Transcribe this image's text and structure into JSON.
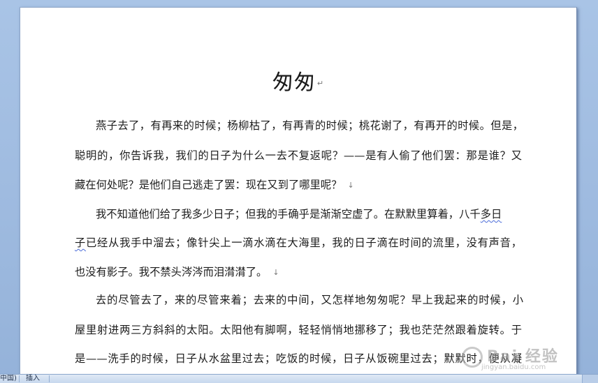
{
  "document": {
    "title": "匆匆",
    "paragraph_mark": "↵",
    "line_break_mark": "↓",
    "lines": [
      "燕子去了，有再来的时候；杨柳枯了，有再青的时候；桃花谢了，有再开的时候。但是，",
      "聪明的，你告诉我，我们的日子为什么一去不复返呢？——是有人偷了他们罢：那是谁？又",
      "藏在何处呢？是他们自己逃走了罢：现在又到了哪里呢？",
      "我不知道他们给了我多少日子；但我的手确乎是渐渐空虚了。在默默里算着，八千",
      "多日",
      "子",
      "已经从我手中溜去；像针尖上一滴水滴在大海里，我的日子滴在时间的流里，没有声音，",
      "也没有影子。我不禁头涔涔而泪潸潸了。",
      "去的尽管去了，来的尽管来着；去来的中间，又怎样地匆匆呢？早上我起来的时候，小",
      "屋里射进两三方斜斜的太阳。太阳他有脚啊，轻轻悄悄地挪移了；我也茫茫然跟着旋转。于",
      "是——洗手的时候，日子从水盆里过去；吃饭的时候，日子从饭碗里过去；默默时，便从凝"
    ]
  },
  "watermark": {
    "main": "Bai 经验",
    "sub": "jingyan.baidu.com"
  },
  "statusbar": {
    "language": "中国)",
    "insert_mode": "插入"
  }
}
